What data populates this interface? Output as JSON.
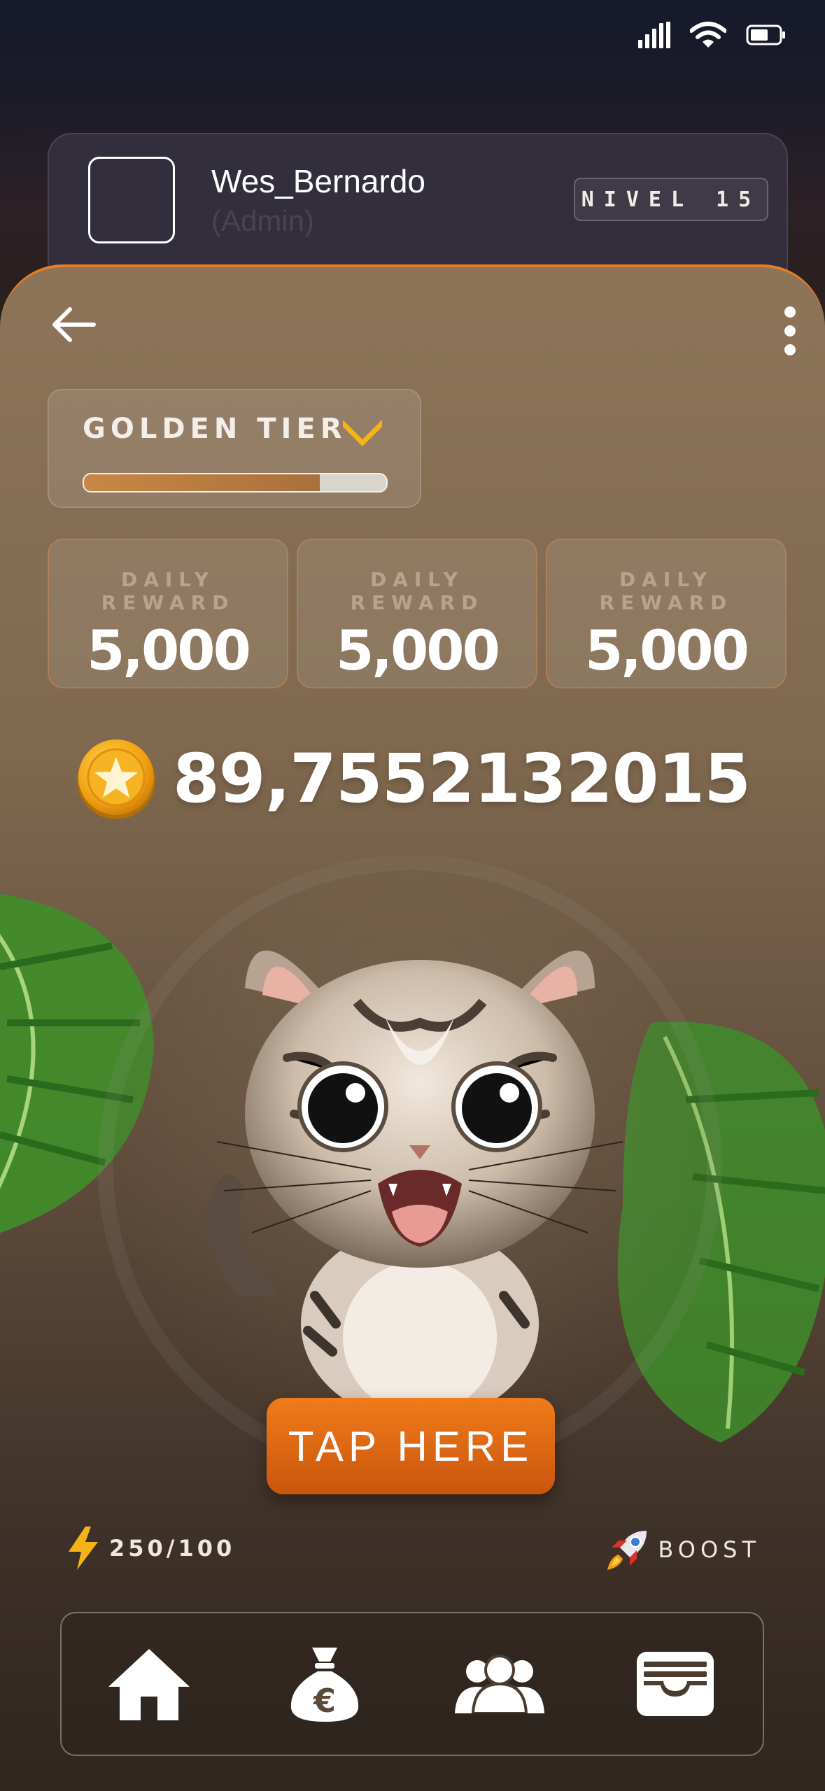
{
  "status_bar": {
    "icons": [
      "cellular-signal-icon",
      "wifi-icon",
      "battery-icon"
    ]
  },
  "profile": {
    "username": "Wes_Bernardo",
    "role": "(Admin)",
    "level_badge": "NIVEL 15"
  },
  "header": {
    "back_icon": "arrow-left-icon",
    "menu_icon": "more-vertical-icon"
  },
  "tier": {
    "label": "GOLDEN TIER",
    "progress": 0.78
  },
  "rewards": [
    {
      "label": "DAILY REWARD",
      "value": "5,000"
    },
    {
      "label": "DAILY REWARD",
      "value": "5,000"
    },
    {
      "label": "DAILY REWARD",
      "value": "5,000"
    }
  ],
  "balance": {
    "value": "89,7552132015",
    "icon": "star-coin-icon"
  },
  "tap_button": {
    "label": "TAP HERE"
  },
  "energy": {
    "text": "250/100",
    "icon": "lightning-icon"
  },
  "boost": {
    "label": "BOOST",
    "icon": "rocket-icon"
  },
  "nav": {
    "items": [
      {
        "name": "home",
        "icon": "home-icon"
      },
      {
        "name": "money-bag",
        "icon": "money-bag-euro-icon"
      },
      {
        "name": "friends",
        "icon": "users-icon"
      },
      {
        "name": "wallet",
        "icon": "wallet-icon"
      }
    ]
  },
  "colors": {
    "accent_orange": "#e87d22",
    "tier_chevron": "#f5b316",
    "coin_gold": "#f3a615",
    "panel_top": "#8d7459",
    "panel_bottom": "#2f2620"
  }
}
